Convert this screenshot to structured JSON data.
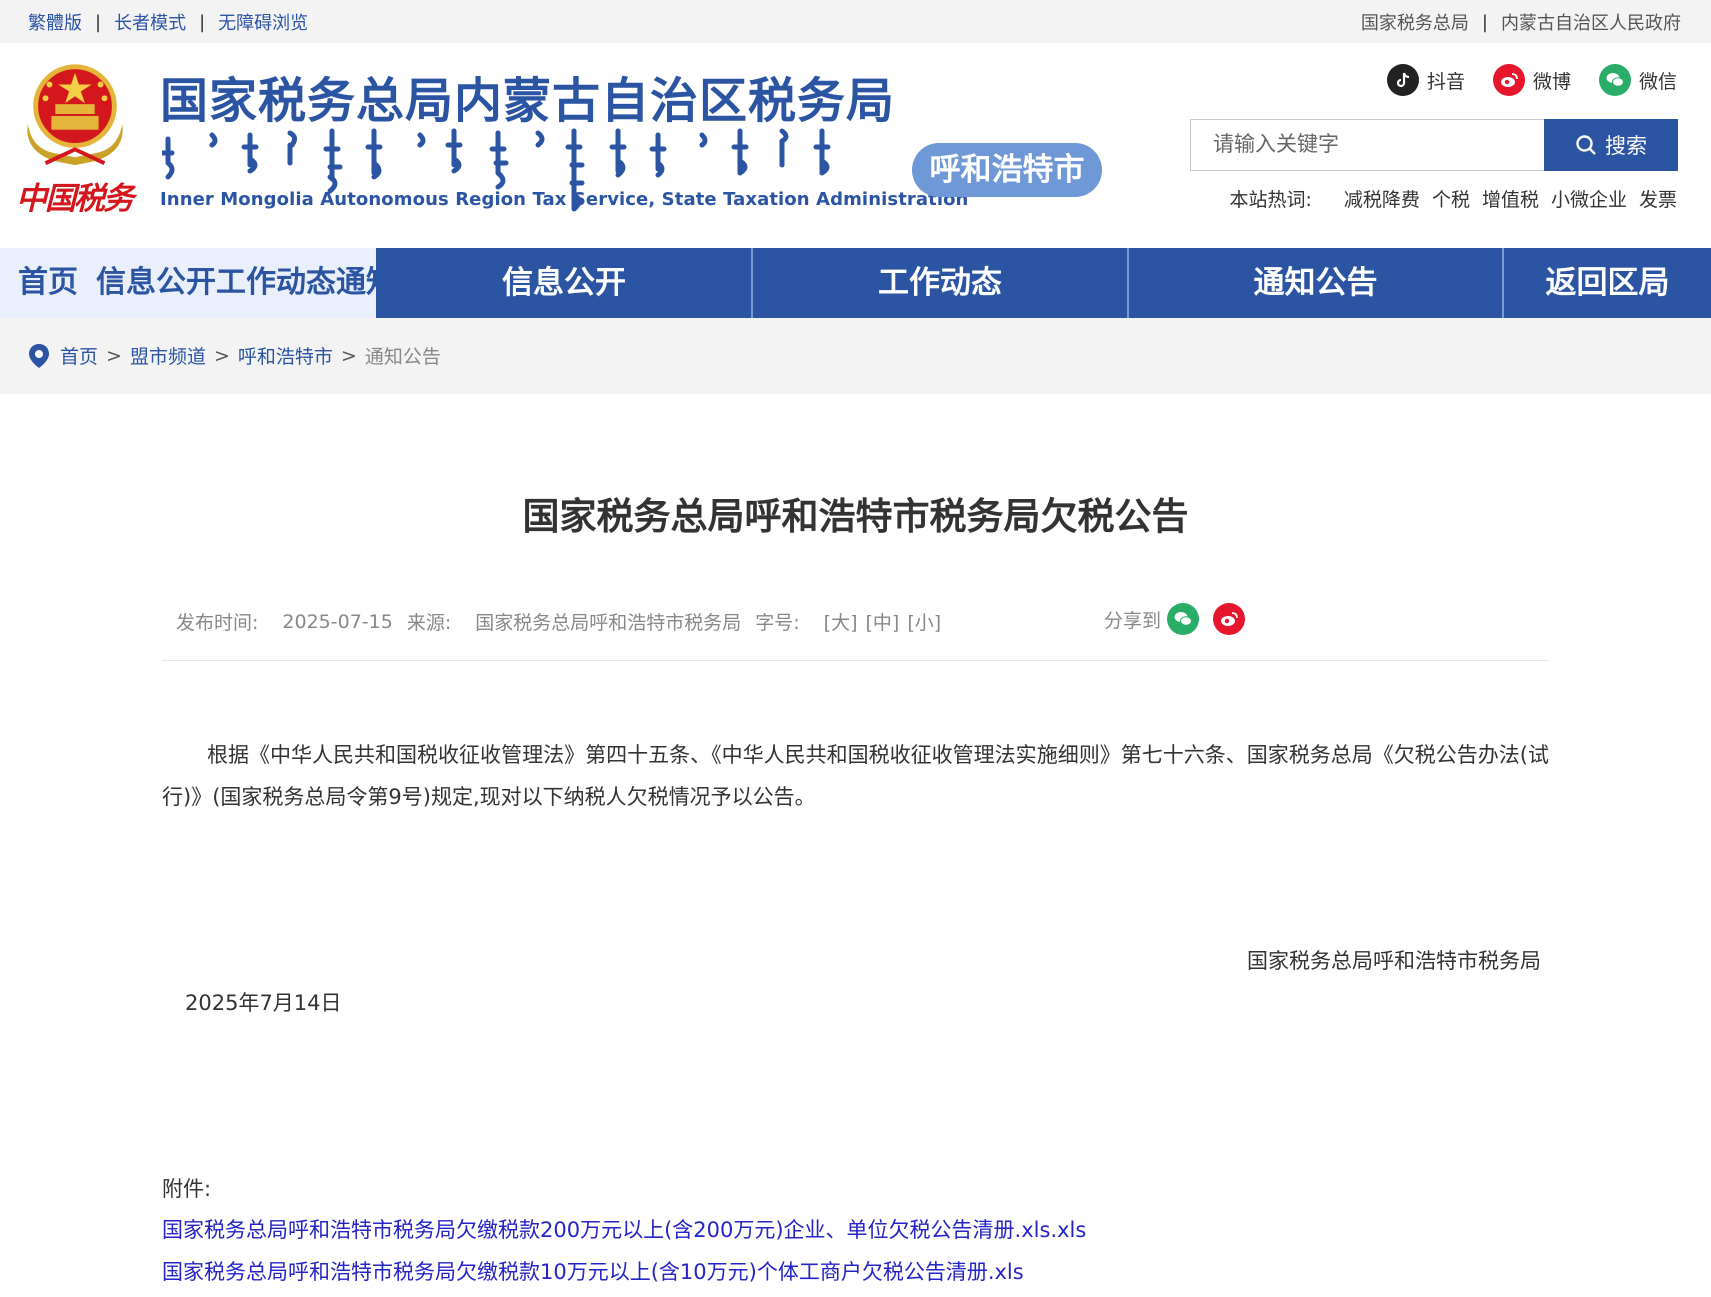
{
  "topbar": {
    "left_links": [
      "繁體版",
      "长者模式",
      "无障碍浏览"
    ],
    "right_links": [
      "国家税务总局",
      "内蒙古自治区人民政府"
    ],
    "separator": "|"
  },
  "header": {
    "brand_cn": "中国税务",
    "site_title": "国家税务总局内蒙古自治区税务局",
    "site_title_en": "Inner Mongolia Autonomous Region Tax Service, State Taxation Administration",
    "city_badge": "呼和浩特市",
    "socials": [
      {
        "label": "抖音",
        "icon": "douyin-icon",
        "color": "#222222"
      },
      {
        "label": "微博",
        "icon": "weibo-icon",
        "color": "#e6162d"
      },
      {
        "label": "微信",
        "icon": "wechat-icon",
        "color": "#2aae67"
      }
    ],
    "search": {
      "placeholder": "请输入关键字",
      "button_label": "搜索"
    },
    "hotwords": {
      "label": "本站热词:",
      "items": [
        "减税降费",
        "个税",
        "增值税",
        "小微企业",
        "发票"
      ]
    }
  },
  "nav": {
    "first_block": [
      "首页",
      "信息公开",
      "工作动态",
      "通知公告"
    ],
    "items": [
      "信息公开",
      "工作动态",
      "通知公告",
      "返回区局"
    ]
  },
  "breadcrumb": {
    "items": [
      "首页",
      "盟市频道",
      "呼和浩特市"
    ],
    "current": "通知公告",
    "separator": ">"
  },
  "article": {
    "title": "国家税务总局呼和浩特市税务局欠税公告",
    "meta": {
      "date_label": "发布时间:",
      "date": "2025-07-15",
      "source_label": "来源:",
      "source": "国家税务总局呼和浩特市税务局",
      "font_label": "字号:",
      "font_sizes": [
        "[大]",
        "[中]",
        "[小]"
      ],
      "share_label": "分享到"
    },
    "body": "根据《中华人民共和国税收征收管理法》第四十五条、《中华人民共和国税收征收管理法实施细则》第七十六条、国家税务总局《欠税公告办法(试行)》(国家税务总局令第9号)规定,现对以下纳税人欠税情况予以公告。",
    "sign_org": "国家税务总局呼和浩特市税务局",
    "sign_date": "2025年7月14日",
    "attachments_label": "附件:",
    "attachments": [
      "国家税务总局呼和浩特市税务局欠缴税款200万元以上(含200万元)企业、单位欠税公告清册.xls.xls",
      "国家税务总局呼和浩特市税务局欠缴税款10万元以上(含10万元)个体工商户欠税公告清册.xls"
    ]
  },
  "colors": {
    "primary": "#2b55a2",
    "badge": "#6f98d6",
    "link": "#2424c7",
    "brand_red": "#d4171d"
  }
}
